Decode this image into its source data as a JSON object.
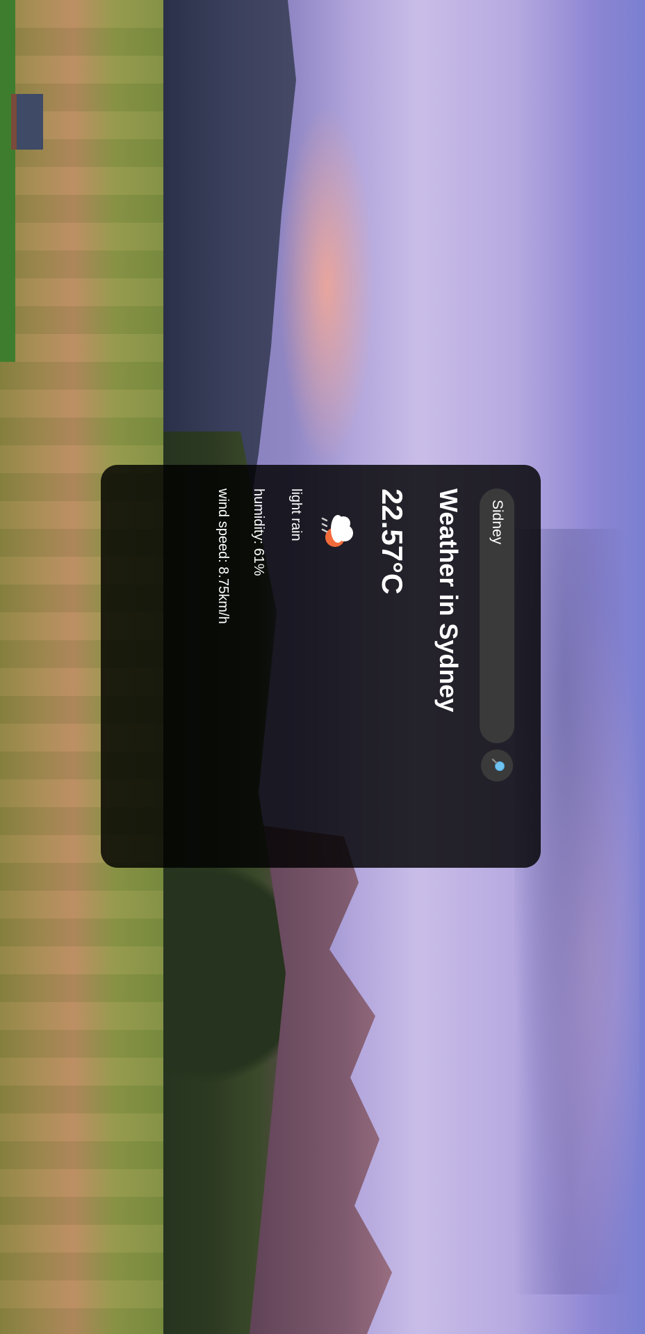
{
  "search": {
    "value": "Sidney",
    "placeholder": "Sidney"
  },
  "weather": {
    "title": "Weather in Sydney",
    "temperature": "22.57°C",
    "description": "light rain",
    "humidity": "humidity: 61%",
    "wind_speed": "wind speed: 8.75km/h",
    "icon": "light-rain-icon"
  },
  "icons": {
    "search_button": "magnifier-icon"
  },
  "colors": {
    "card_background": "#000000",
    "input_background": "#3a3a3a",
    "text": "#ffffff",
    "sun_accent": "#f26b3a",
    "search_glass": "#6fc3f0"
  }
}
